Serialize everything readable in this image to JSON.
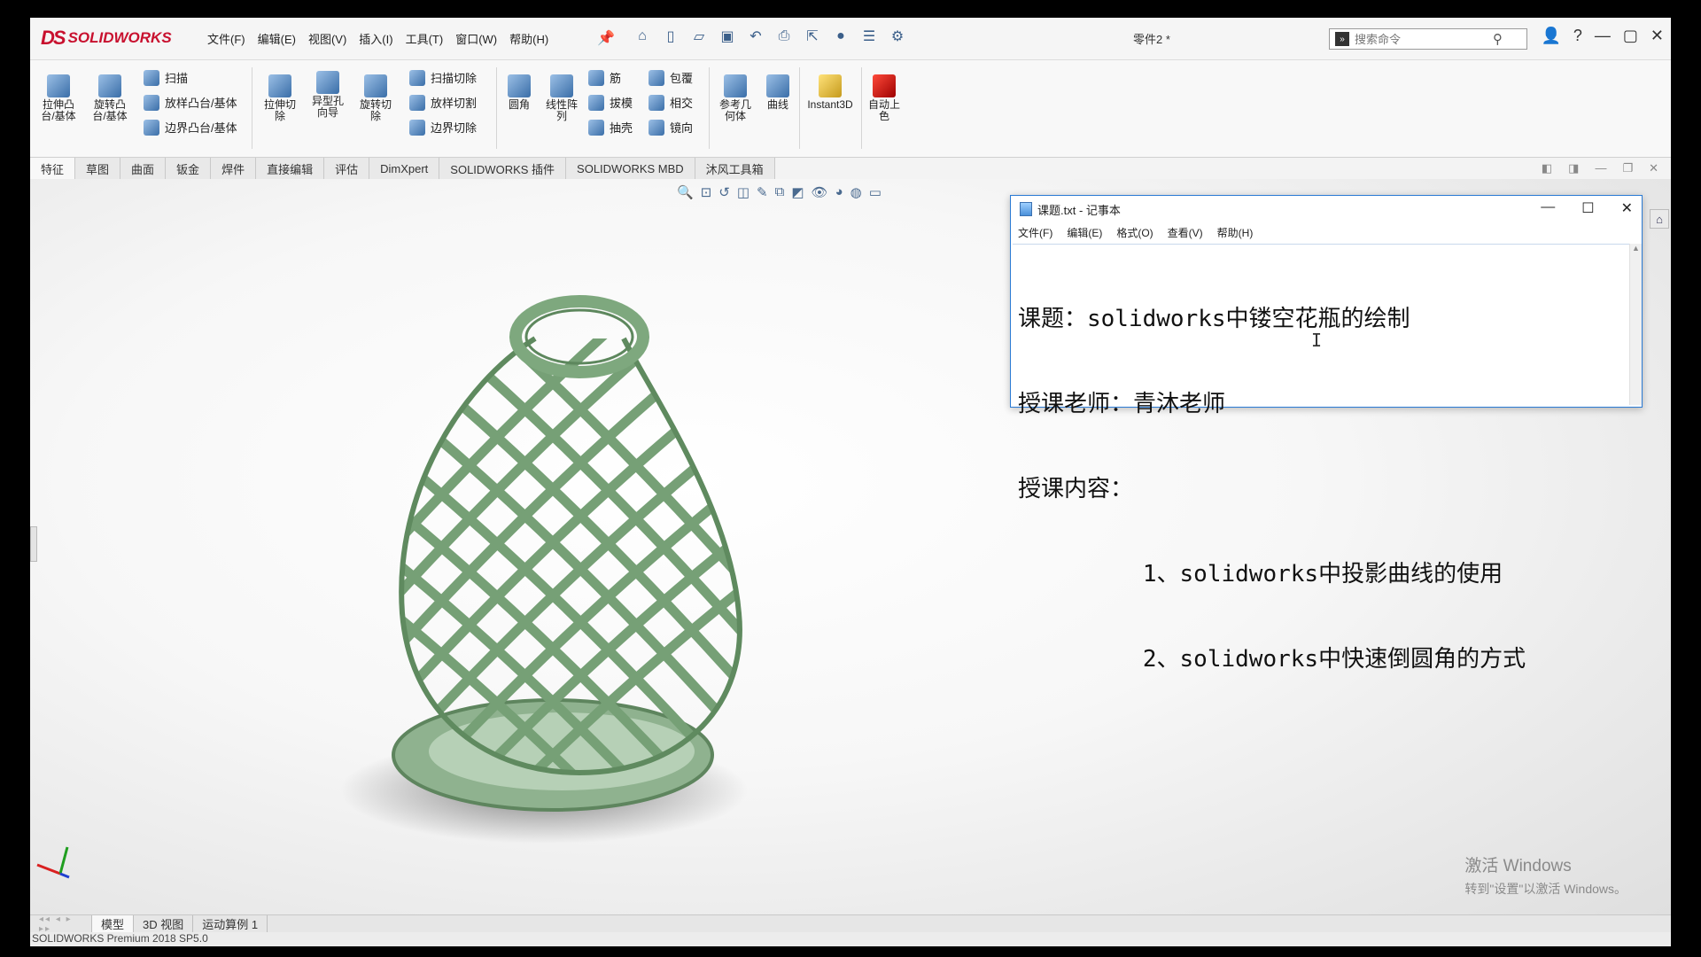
{
  "app": {
    "logo_prefix": "DS",
    "logo_text": "SOLIDWORKS",
    "document_title": "零件2 *"
  },
  "menu": [
    "文件(F)",
    "编辑(E)",
    "视图(V)",
    "插入(I)",
    "工具(T)",
    "窗口(W)",
    "帮助(H)"
  ],
  "search": {
    "placeholder": "搜索命令"
  },
  "ribbon": {
    "extrude_boss": "拉伸凸\n台/基体",
    "revolve_boss": "旋转凸\n台/基体",
    "sweep": "扫描",
    "loft_boss": "放样凸台/基体",
    "boundary_boss": "边界凸台/基体",
    "extrude_cut": "拉伸切\n除",
    "hole_wizard": "异型孔\n向导",
    "revolve_cut": "旋转切\n除",
    "sweep_cut": "扫描切除",
    "loft_cut": "放样切割",
    "boundary_cut": "边界切除",
    "fillet": "圆角",
    "linear_pattern": "线性阵\n列",
    "rib": "筋",
    "draft": "拔模",
    "shell": "抽壳",
    "wrap": "包覆",
    "intersect": "相交",
    "mirror": "镜向",
    "ref_geometry": "参考几\n何体",
    "curves": "曲线",
    "instant3d": "Instant3D",
    "auto_color": "自动上\n色"
  },
  "tabs": [
    "特征",
    "草图",
    "曲面",
    "钣金",
    "焊件",
    "直接编辑",
    "评估",
    "DimXpert",
    "SOLIDWORKS 插件",
    "SOLIDWORKS MBD",
    "沐风工具箱"
  ],
  "notepad": {
    "title": "课题.txt - 记事本",
    "menu": [
      "文件(F)",
      "编辑(E)",
      "格式(O)",
      "查看(V)",
      "帮助(H)"
    ],
    "lines": [
      "课题：solidworks中镂空花瓶的绘制",
      "授课老师：青沐老师",
      "授课内容：",
      "         1、solidworks中投影曲线的使用",
      "         2、solidworks中快速倒圆角的方式"
    ]
  },
  "watermark": {
    "line1": "激活 Windows",
    "line2": "转到\"设置\"以激活 Windows。"
  },
  "bottom_tabs": [
    "模型",
    "3D 视图",
    "运动算例 1"
  ],
  "status": "SOLIDWORKS Premium 2018 SP5.0",
  "colors": {
    "vase": "#7fa67f",
    "brand_red": "#c8102e",
    "notepad_border": "#2a7ad4"
  }
}
